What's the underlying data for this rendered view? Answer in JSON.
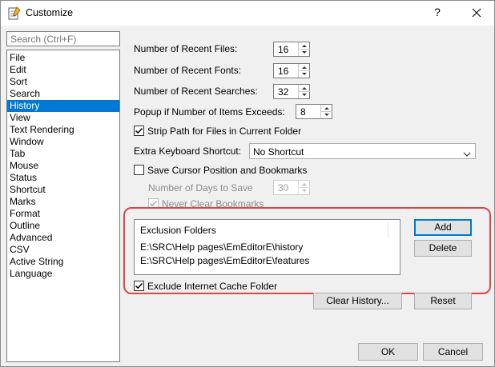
{
  "window": {
    "title": "Customize",
    "help_glyph": "?",
    "icons": {
      "app": "notepad-icon",
      "close": "close-icon"
    }
  },
  "search": {
    "placeholder": "Search (Ctrl+F)"
  },
  "categories": {
    "selected": "History",
    "items": [
      "File",
      "Edit",
      "Sort",
      "Search",
      "History",
      "View",
      "Text Rendering",
      "Window",
      "Tab",
      "Mouse",
      "Status",
      "Shortcut",
      "Marks",
      "Format",
      "Outline",
      "Advanced",
      "CSV",
      "Active String",
      "Language"
    ]
  },
  "settings": {
    "recent_files": {
      "label": "Number of Recent Files:",
      "value": "16"
    },
    "recent_fonts": {
      "label": "Number of Recent Fonts:",
      "value": "16"
    },
    "recent_searches": {
      "label": "Number of Recent Searches:",
      "value": "32"
    },
    "popup_items": {
      "label": "Popup if Number of Items Exceeds:",
      "value": "8"
    },
    "strip_path": {
      "label": "Strip Path for Files in Current Folder",
      "checked": true
    },
    "keyboard_shortcut": {
      "label": "Extra Keyboard Shortcut:",
      "value": "No Shortcut"
    },
    "save_cursor": {
      "label": "Save Cursor Position and Bookmarks",
      "checked": false
    },
    "days_to_save": {
      "label": "Number of Days to Save",
      "value": "30",
      "enabled": false
    },
    "never_clear": {
      "label": "Never Clear Bookmarks",
      "checked": true,
      "enabled": false
    },
    "exclusion": {
      "header": "Exclusion Folders",
      "folders": [
        "E:\\SRC\\Help pages\\EmEditorE\\history",
        "E:\\SRC\\Help pages\\EmEditorE\\features"
      ]
    },
    "exclude_cache": {
      "label": "Exclude Internet Cache Folder",
      "checked": true
    }
  },
  "buttons": {
    "add": "Add",
    "delete": "Delete",
    "clear_history": "Clear History...",
    "reset": "Reset",
    "ok": "OK",
    "cancel": "Cancel"
  },
  "colors": {
    "selection": "#0078d7",
    "highlight": "#d9474a",
    "default_button_border": "#0078d7"
  }
}
